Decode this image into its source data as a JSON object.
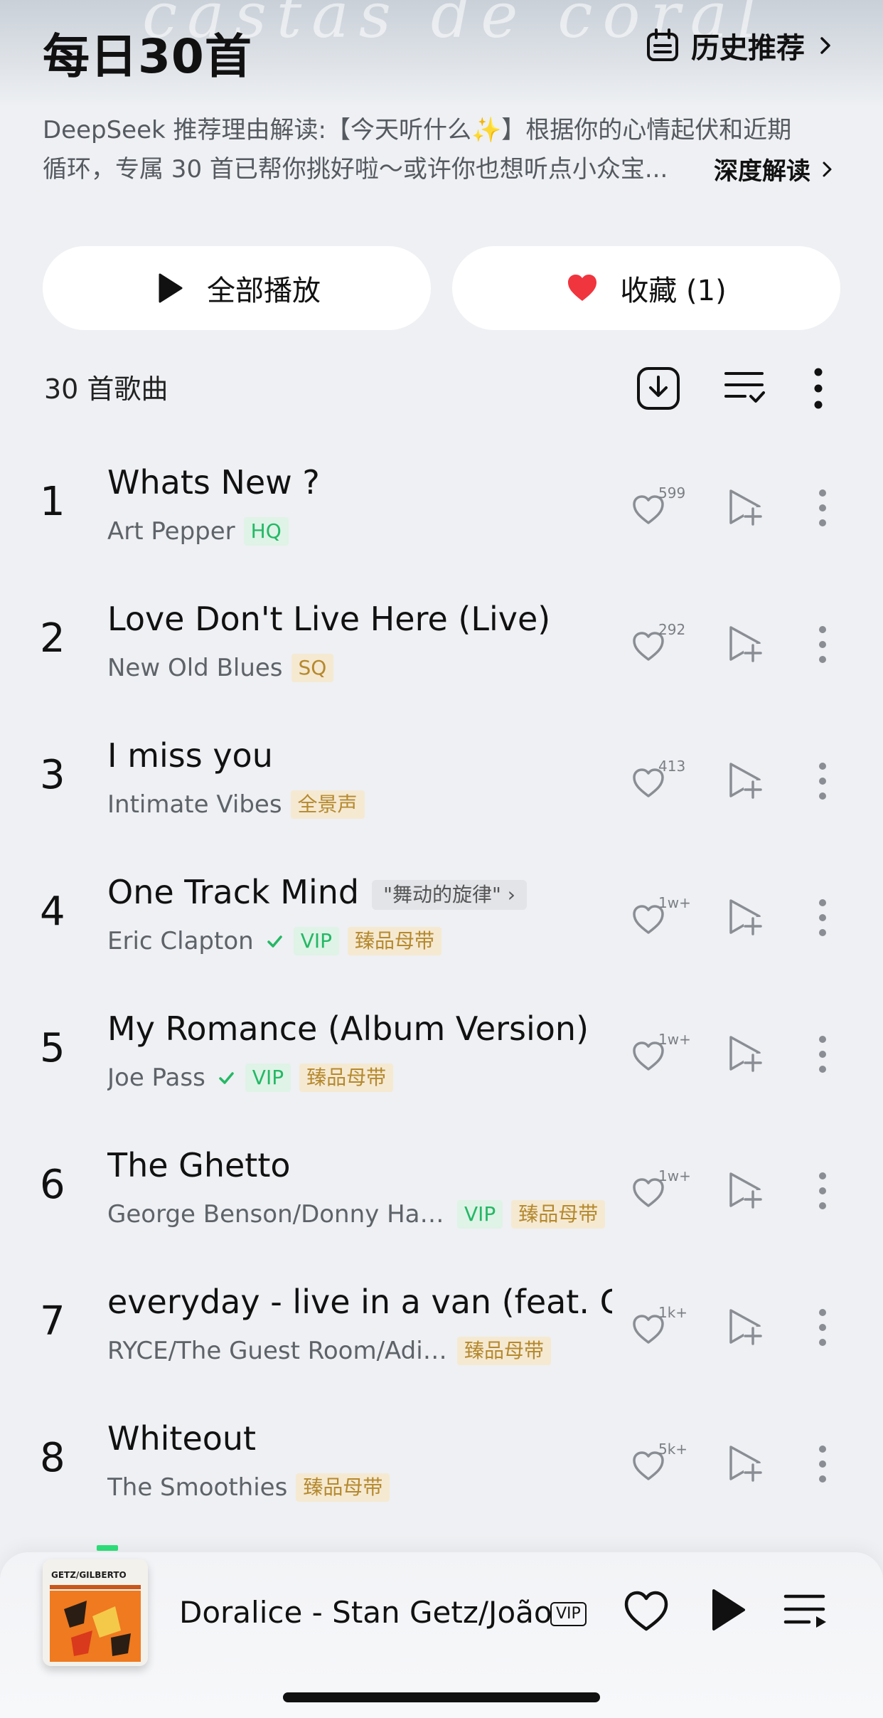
{
  "header": {
    "bg_text": "castas de coral",
    "title": "每日30首",
    "history_label": "历史推荐"
  },
  "reason": {
    "line1": "DeepSeek 推荐理由解读:【今天听什么✨】根据你的心情起伏和近期",
    "line2": "循环，专属 30 首已帮你挑好啦～或许你也想听点小众宝...",
    "deep_read_label": "深度解读"
  },
  "actions": {
    "play_all_label": "全部播放",
    "favorite_label": "收藏 (1)"
  },
  "list_header": {
    "count_label": "30 首歌曲"
  },
  "songs": [
    {
      "num": "1",
      "title": "Whats New ?",
      "title_tag": "",
      "artist": "Art Pepper",
      "verified": false,
      "badges": [
        {
          "text": "HQ",
          "color": "green"
        }
      ],
      "likes": "599"
    },
    {
      "num": "2",
      "title": "Love Don't Live Here (Live)",
      "title_tag": "",
      "artist": "New Old Blues",
      "verified": false,
      "badges": [
        {
          "text": "SQ",
          "color": "gold"
        }
      ],
      "likes": "292"
    },
    {
      "num": "3",
      "title": "I miss you",
      "title_tag": "",
      "artist": "Intimate Vibes",
      "verified": false,
      "badges": [
        {
          "text": "全景声",
          "color": "gold"
        }
      ],
      "likes": "413"
    },
    {
      "num": "4",
      "title": "One Track Mind",
      "title_tag": "\"舞动的旋律\" ›",
      "artist": "Eric Clapton",
      "verified": true,
      "badges": [
        {
          "text": "VIP",
          "color": "green"
        },
        {
          "text": "臻品母带",
          "color": "gold"
        }
      ],
      "likes": "1w+"
    },
    {
      "num": "5",
      "title": "My Romance (Album Version)",
      "title_tag": "",
      "artist": "Joe Pass",
      "verified": true,
      "badges": [
        {
          "text": "VIP",
          "color": "green"
        },
        {
          "text": "臻品母带",
          "color": "gold"
        }
      ],
      "likes": "1w+"
    },
    {
      "num": "6",
      "title": "The Ghetto",
      "title_tag": "",
      "artist": "George Benson/Donny Hat...",
      "verified": false,
      "badges": [
        {
          "text": "VIP",
          "color": "green"
        },
        {
          "text": "臻品母带",
          "color": "gold"
        }
      ],
      "likes": "1w+"
    },
    {
      "num": "7",
      "title": "everyday - live in a van (feat. C...",
      "title_tag": "",
      "artist": "RYCE/The Guest Room/Adison...",
      "verified": false,
      "badges": [
        {
          "text": "臻品母带",
          "color": "gold"
        }
      ],
      "likes": "1k+"
    },
    {
      "num": "8",
      "title": "Whiteout",
      "title_tag": "",
      "artist": "The Smoothies",
      "verified": false,
      "badges": [
        {
          "text": "臻品母带",
          "color": "gold"
        }
      ],
      "likes": "5k+"
    }
  ],
  "player": {
    "cover_text": "GETZ/GILBERTO",
    "now_playing": "Doralice - Stan Getz/João",
    "vip_label": "VIP"
  },
  "colors": {
    "accent_green": "#25b865",
    "gold": "#b5892e",
    "heart_red": "#f0353f",
    "background": "#eef0f3"
  }
}
